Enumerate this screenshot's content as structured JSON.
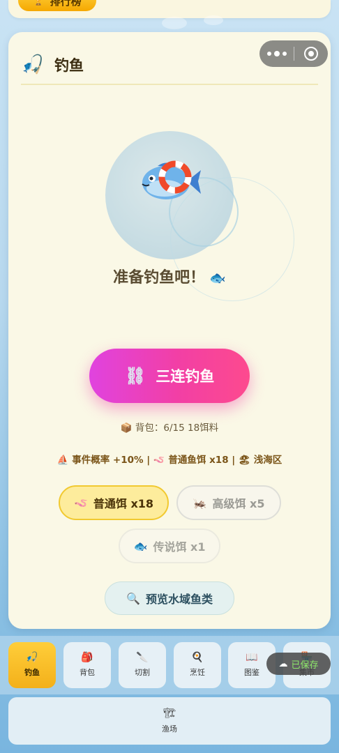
{
  "top": {
    "rank_label": "排行榜",
    "rank_icon": "trophy-icon"
  },
  "card": {
    "title": "钓鱼",
    "title_icon": "fishing-rod-icon"
  },
  "scene": {
    "status_text": "准备钓鱼吧！",
    "status_emoji": "🐟"
  },
  "cast_button": {
    "label": "三连钓鱼",
    "icon": "⛓"
  },
  "bag_info": "📦 背包：6/15 18饵料",
  "event_info": "⛵ 事件概率 +10% | 🪱 普通鱼饵 x18 | 🏖 浅海区",
  "baits": [
    {
      "icon": "🪱",
      "label": "普通饵 x18",
      "selected": true
    },
    {
      "icon": "🦗",
      "label": "高级饵 x5",
      "selected": false
    },
    {
      "icon": "🐟",
      "label": "传说饵 x1",
      "selected": false
    }
  ],
  "preview_button": {
    "icon": "🔍",
    "label": "预览水域鱼类"
  },
  "nav": {
    "tabs": [
      {
        "icon": "🎣",
        "label": "钓鱼",
        "active": true
      },
      {
        "icon": "🎒",
        "label": "背包"
      },
      {
        "icon": "🔪",
        "label": "切割"
      },
      {
        "icon": "🍳",
        "label": "烹饪"
      },
      {
        "icon": "📖",
        "label": "图鉴"
      },
      {
        "icon": "🏪",
        "label": "集市"
      }
    ],
    "fishery": {
      "icon": "🏗",
      "label": "渔场"
    }
  },
  "toast": {
    "icon": "☁",
    "label": "已保存"
  },
  "colors": {
    "accent_pink": "#f23fa5",
    "accent_yellow": "#f3b01a",
    "card_bg": "#faf8e6"
  }
}
